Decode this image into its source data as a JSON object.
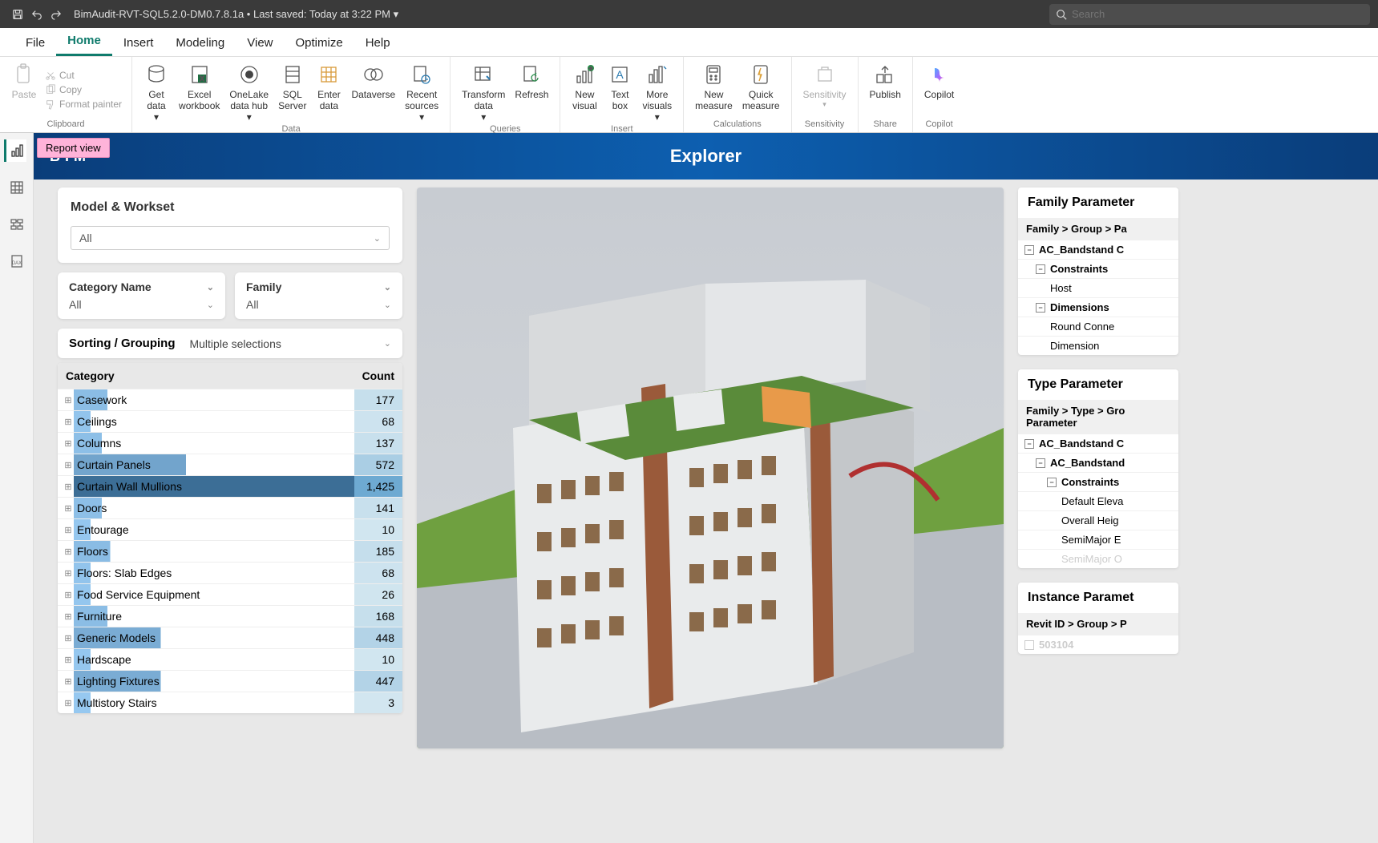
{
  "titlebar": {
    "filename": "BimAudit-RVT-SQL5.2.0-DM0.7.8.1a",
    "saved": "Last saved: Today at 3:22 PM",
    "search_placeholder": "Search"
  },
  "menu": {
    "file": "File",
    "home": "Home",
    "insert": "Insert",
    "modeling": "Modeling",
    "view": "View",
    "optimize": "Optimize",
    "help": "Help"
  },
  "ribbon": {
    "paste": "Paste",
    "cut": "Cut",
    "copy": "Copy",
    "format_painter": "Format painter",
    "clipboard": "Clipboard",
    "get_data": "Get\ndata",
    "excel": "Excel\nworkbook",
    "onelake": "OneLake\ndata hub",
    "sql": "SQL\nServer",
    "enter": "Enter\ndata",
    "dataverse": "Dataverse",
    "recent": "Recent\nsources",
    "data": "Data",
    "transform": "Transform\ndata",
    "refresh": "Refresh",
    "queries": "Queries",
    "new_visual": "New\nvisual",
    "text_box": "Text\nbox",
    "more_visuals": "More\nvisuals",
    "insert": "Insert",
    "new_measure": "New\nmeasure",
    "quick_measure": "Quick\nmeasure",
    "calculations": "Calculations",
    "sensitivity": "Sensitivity",
    "sensitivity_g": "Sensitivity",
    "publish": "Publish",
    "share": "Share",
    "copilot": "Copilot",
    "copilot_g": "Copilot"
  },
  "tooltip": "Report view",
  "explorer": {
    "brand": "BIM",
    "title": "Explorer"
  },
  "mw": {
    "title": "Model & Workset",
    "all": "All"
  },
  "filters": {
    "category": "Category Name",
    "family": "Family",
    "all": "All"
  },
  "sorting": {
    "label": "Sorting / Grouping",
    "value": "Multiple selections"
  },
  "table": {
    "cat_header": "Category",
    "count_header": "Count",
    "rows": [
      {
        "c": "Casework",
        "n": "177"
      },
      {
        "c": "Ceilings",
        "n": "68"
      },
      {
        "c": "Columns",
        "n": "137"
      },
      {
        "c": "Curtain Panels",
        "n": "572"
      },
      {
        "c": "Curtain Wall Mullions",
        "n": "1,425"
      },
      {
        "c": "Doors",
        "n": "141"
      },
      {
        "c": "Entourage",
        "n": "10"
      },
      {
        "c": "Floors",
        "n": "185"
      },
      {
        "c": "Floors: Slab Edges",
        "n": "68"
      },
      {
        "c": "Food Service Equipment",
        "n": "26"
      },
      {
        "c": "Furniture",
        "n": "168"
      },
      {
        "c": "Generic Models",
        "n": "448"
      },
      {
        "c": "Hardscape",
        "n": "10"
      },
      {
        "c": "Lighting Fixtures",
        "n": "447"
      },
      {
        "c": "Multistory Stairs",
        "n": "3"
      }
    ]
  },
  "fam_param": {
    "title": "Family Parameter",
    "sub": "Family > Group > Pa",
    "r1": "AC_Bandstand C",
    "r2": "Constraints",
    "r3": "Host",
    "r4": "Dimensions",
    "r5": "Round Conne",
    "r6": "Dimension"
  },
  "type_param": {
    "title": "Type Parameter",
    "sub": "Family > Type > Gro Parameter",
    "r1": "AC_Bandstand C",
    "r2": "AC_Bandstand",
    "r3": "Constraints",
    "r4": "Default Eleva",
    "r5": "Overall Heig",
    "r6": "SemiMajor E",
    "r7": "SemiMajor O"
  },
  "inst_param": {
    "title": "Instance Paramet",
    "sub": "Revit ID > Group > P",
    "r1": "503104"
  }
}
